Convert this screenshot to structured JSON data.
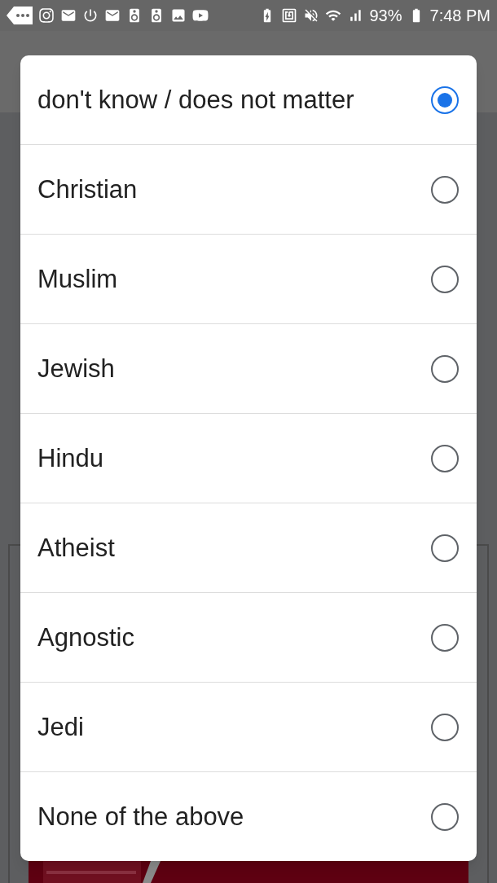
{
  "status_bar": {
    "battery_percent": "93%",
    "time": "7:48 PM"
  },
  "dialog": {
    "options": [
      {
        "label": "don't know / does not matter",
        "selected": true
      },
      {
        "label": "Christian",
        "selected": false
      },
      {
        "label": "Muslim",
        "selected": false
      },
      {
        "label": "Jewish",
        "selected": false
      },
      {
        "label": "Hindu",
        "selected": false
      },
      {
        "label": "Atheist",
        "selected": false
      },
      {
        "label": "Agnostic",
        "selected": false
      },
      {
        "label": "Jedi",
        "selected": false
      },
      {
        "label": "None of the above",
        "selected": false
      }
    ]
  }
}
